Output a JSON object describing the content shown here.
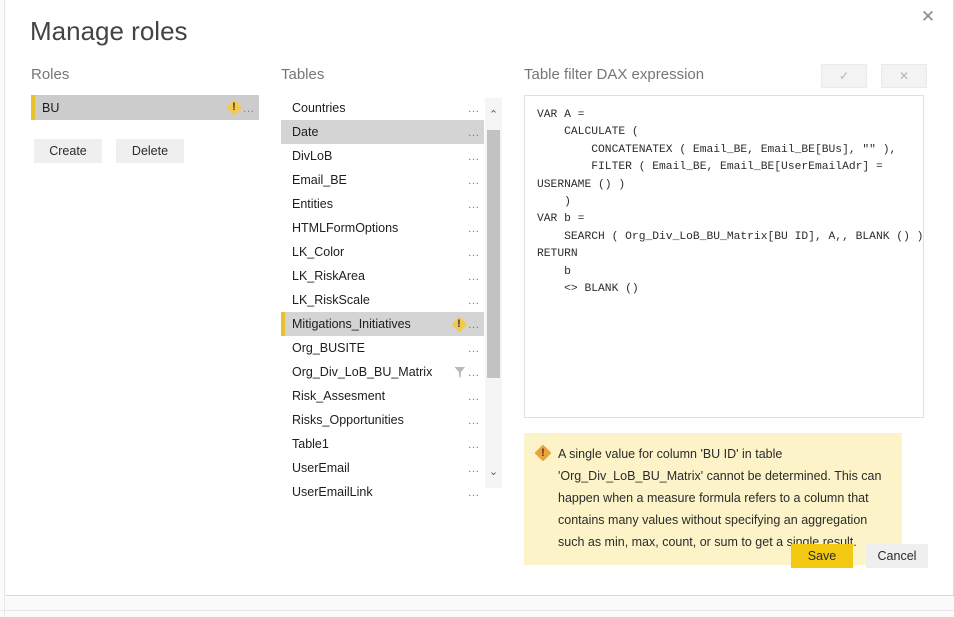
{
  "dialog": {
    "title": "Manage roles",
    "close_label": "✕"
  },
  "roles": {
    "label": "Roles",
    "items": [
      {
        "name": "BU",
        "selected": true,
        "has_warning": true
      }
    ],
    "create_label": "Create",
    "delete_label": "Delete"
  },
  "tables": {
    "label": "Tables",
    "items": [
      {
        "name": "Countries",
        "state": "normal",
        "icon": "none"
      },
      {
        "name": "Date",
        "state": "hover",
        "icon": "none"
      },
      {
        "name": "DivLoB",
        "state": "normal",
        "icon": "none"
      },
      {
        "name": "Email_BE",
        "state": "normal",
        "icon": "none"
      },
      {
        "name": "Entities",
        "state": "normal",
        "icon": "none"
      },
      {
        "name": "HTMLFormOptions",
        "state": "normal",
        "icon": "none"
      },
      {
        "name": "LK_Color",
        "state": "normal",
        "icon": "none"
      },
      {
        "name": "LK_RiskArea",
        "state": "normal",
        "icon": "none"
      },
      {
        "name": "LK_RiskScale",
        "state": "normal",
        "icon": "none"
      },
      {
        "name": "Mitigations_Initiatives",
        "state": "active",
        "icon": "warning"
      },
      {
        "name": "Org_BUSITE",
        "state": "normal",
        "icon": "none"
      },
      {
        "name": "Org_Div_LoB_BU_Matrix",
        "state": "normal",
        "icon": "filter"
      },
      {
        "name": "Risk_Assesment",
        "state": "normal",
        "icon": "none"
      },
      {
        "name": "Risks_Opportunities",
        "state": "normal",
        "icon": "none"
      },
      {
        "name": "Table1",
        "state": "normal",
        "icon": "none"
      },
      {
        "name": "UserEmail",
        "state": "normal",
        "icon": "none"
      },
      {
        "name": "UserEmailLink",
        "state": "normal",
        "icon": "none"
      }
    ],
    "ellipsis": "…",
    "scroll_up": "⌃",
    "scroll_down": "⌄"
  },
  "dax": {
    "label": "Table filter DAX expression",
    "accept_label": "✓",
    "revert_label": "✕",
    "expression": "VAR A =\n    CALCULATE (\n        CONCATENATEX ( Email_BE, Email_BE[BUs], \"\" ),\n        FILTER ( Email_BE, Email_BE[UserEmailAdr] =\nUSERNAME () )\n    )\nVAR b =\n    SEARCH ( Org_Div_LoB_BU_Matrix[BU ID], A,, BLANK () )\nRETURN\n    b\n    <> BLANK ()"
  },
  "error": {
    "message": "A single value for column 'BU ID' in table 'Org_Div_LoB_BU_Matrix' cannot be determined. This can happen when a measure formula refers to a column that contains many values without specifying an aggregation such as min, max, count, or sum to get a single result."
  },
  "footer": {
    "save_label": "Save",
    "cancel_label": "Cancel"
  },
  "colors": {
    "accent_yellow": "#f2c811",
    "warning_bg": "#fcf4c8",
    "selected_row": "#d4d4d4",
    "role_marker": "#e8c029"
  }
}
